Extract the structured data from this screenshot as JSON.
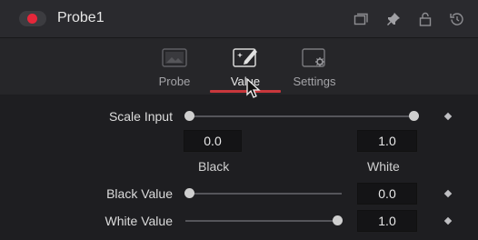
{
  "header": {
    "title": "Probe1",
    "toggle_color": "#e5273a",
    "icons": [
      "copy-icon",
      "pin-icon",
      "lock-icon",
      "reset-icon"
    ]
  },
  "tabs": [
    {
      "label": "Probe",
      "icon": "probe-tab-icon",
      "active": false
    },
    {
      "label": "Value",
      "icon": "value-tab-icon",
      "active": true
    },
    {
      "label": "Settings",
      "icon": "settings-tab-icon",
      "active": false
    }
  ],
  "controls": {
    "scale_input": {
      "label": "Scale Input",
      "black_value": "0.0",
      "white_value": "1.0",
      "black_label": "Black",
      "white_label": "White"
    },
    "black_value": {
      "label": "Black Value",
      "value": "0.0"
    },
    "white_value": {
      "label": "White Value",
      "value": "1.0"
    }
  },
  "colors": {
    "accent": "#c9373c"
  }
}
